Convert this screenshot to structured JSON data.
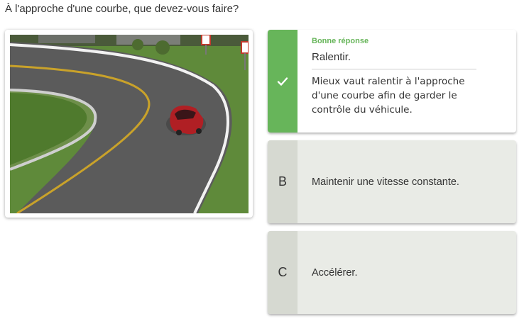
{
  "question": "À l'approche d'une courbe, que devez-vous faire?",
  "answers": [
    {
      "letter": "",
      "status": "Bonne réponse",
      "text": "Ralentir.",
      "explanation": "Mieux vaut ralentir à l'approche d'une courbe afin de garder le contrôle du véhicule.",
      "icon": "check-icon",
      "accent": "#67b55a"
    },
    {
      "letter": "B",
      "text": "Maintenir une vitesse constante."
    },
    {
      "letter": "C",
      "text": "Accélérer."
    }
  ],
  "colors": {
    "correct_accent": "#67b55a",
    "letter_bg": "#d6d9d1",
    "card_bg": "#e9ebe6"
  },
  "image": {
    "depicts": [
      "curved-road",
      "red-car",
      "chevron-signs",
      "grass"
    ]
  }
}
